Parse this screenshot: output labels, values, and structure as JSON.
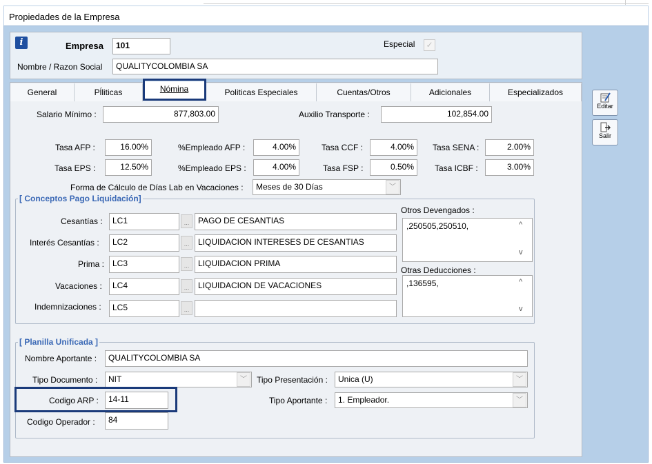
{
  "window": {
    "title": "Propiedades de la Empresa"
  },
  "header": {
    "empresa_label": "Empresa",
    "empresa_value": "101",
    "especial_label": "Especial",
    "razon_label": "Nombre / Razon Social",
    "razon_value": "QUALITYCOLOMBIA SA"
  },
  "tabs": [
    {
      "label": "General"
    },
    {
      "label": "Pĺliticas"
    },
    {
      "label": "Nómina",
      "active": true
    },
    {
      "label": "Politicas Especiales"
    },
    {
      "label": "Cuentas/Otros"
    },
    {
      "label": "Adicionales"
    },
    {
      "label": "Especializados"
    }
  ],
  "salario": {
    "label": "Salario Mínimo :",
    "value": "877,803.00"
  },
  "auxilio": {
    "label": "Auxilio Transporte :",
    "value": "102,854.00"
  },
  "tasas": {
    "afp": {
      "label": "Tasa AFP :",
      "value": "16.00%"
    },
    "emp_afp": {
      "label": "%Empleado AFP :",
      "value": "4.00%"
    },
    "ccf": {
      "label": "Tasa CCF :",
      "value": "4.00%"
    },
    "sena": {
      "label": "Tasa SENA :",
      "value": "2.00%"
    },
    "eps": {
      "label": "Tasa EPS :",
      "value": "12.50%"
    },
    "emp_eps": {
      "label": "%Empleado EPS :",
      "value": "4.00%"
    },
    "fsp": {
      "label": "Tasa FSP :",
      "value": "0.50%"
    },
    "icbf": {
      "label": "Tasa ICBF :",
      "value": "3.00%"
    }
  },
  "vacaciones_calc": {
    "label": "Forma de Cálculo de Días Lab en Vacaciones :",
    "value": "Meses de 30 Días"
  },
  "conceptos": {
    "title": "[ Conceptos Pago Liquidación]",
    "rows": [
      {
        "label": "Cesantías :",
        "code": "LC1",
        "desc": "PAGO DE CESANTIAS"
      },
      {
        "label": "Interés Cesantías :",
        "code": "LC2",
        "desc": "LIQUIDACION INTERESES DE CESANTIAS"
      },
      {
        "label": "Prima :",
        "code": "LC3",
        "desc": "LIQUIDACION PRIMA"
      },
      {
        "label": "Vacaciones :",
        "code": "LC4",
        "desc": "LIQUIDACION DE VACACIONES"
      },
      {
        "label": "Indemnizaciones :",
        "code": "LC5",
        "desc": ""
      }
    ],
    "ellipsis": "...",
    "otros_devengados_label": "Otros Devengados :",
    "otros_devengados_value": ",250505,250510,",
    "otras_deducciones_label": "Otras Deducciones :",
    "otras_deducciones_value": ",136595,"
  },
  "planilla": {
    "title": "[ Planilla Unificada ]",
    "aportante_label": "Nombre Aportante :",
    "aportante_value": "QUALITYCOLOMBIA SA",
    "tipo_doc_label": "Tipo Documento :",
    "tipo_doc_value": "NIT",
    "tipo_pres_label": "Tipo Presentación :",
    "tipo_pres_value": "Unica (U)",
    "arp_label": "Codigo ARP :",
    "arp_value": "14-11",
    "tipo_aport_label": "Tipo Aportante :",
    "tipo_aport_value": "1. Empleador.",
    "operador_label": "Codigo Operador :",
    "operador_value": "84"
  },
  "side_buttons": {
    "edit_label": "Editar",
    "exit_label": "Salir"
  },
  "colors": {
    "frame": "#b6cfe8",
    "highlight": "#1a3a7a",
    "group_title": "#3a68b5"
  }
}
